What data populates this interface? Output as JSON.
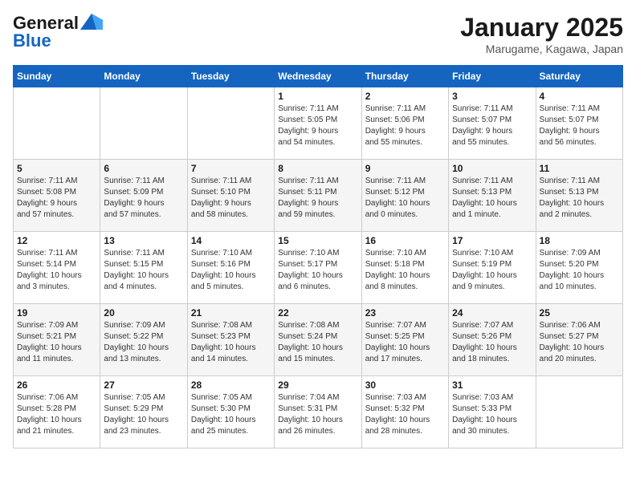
{
  "header": {
    "logo_line1": "General",
    "logo_line2": "Blue",
    "month": "January 2025",
    "location": "Marugame, Kagawa, Japan"
  },
  "weekdays": [
    "Sunday",
    "Monday",
    "Tuesday",
    "Wednesday",
    "Thursday",
    "Friday",
    "Saturday"
  ],
  "weeks": [
    [
      {
        "day": "",
        "info": ""
      },
      {
        "day": "",
        "info": ""
      },
      {
        "day": "",
        "info": ""
      },
      {
        "day": "1",
        "info": "Sunrise: 7:11 AM\nSunset: 5:05 PM\nDaylight: 9 hours\nand 54 minutes."
      },
      {
        "day": "2",
        "info": "Sunrise: 7:11 AM\nSunset: 5:06 PM\nDaylight: 9 hours\nand 55 minutes."
      },
      {
        "day": "3",
        "info": "Sunrise: 7:11 AM\nSunset: 5:07 PM\nDaylight: 9 hours\nand 55 minutes."
      },
      {
        "day": "4",
        "info": "Sunrise: 7:11 AM\nSunset: 5:07 PM\nDaylight: 9 hours\nand 56 minutes."
      }
    ],
    [
      {
        "day": "5",
        "info": "Sunrise: 7:11 AM\nSunset: 5:08 PM\nDaylight: 9 hours\nand 57 minutes."
      },
      {
        "day": "6",
        "info": "Sunrise: 7:11 AM\nSunset: 5:09 PM\nDaylight: 9 hours\nand 57 minutes."
      },
      {
        "day": "7",
        "info": "Sunrise: 7:11 AM\nSunset: 5:10 PM\nDaylight: 9 hours\nand 58 minutes."
      },
      {
        "day": "8",
        "info": "Sunrise: 7:11 AM\nSunset: 5:11 PM\nDaylight: 9 hours\nand 59 minutes."
      },
      {
        "day": "9",
        "info": "Sunrise: 7:11 AM\nSunset: 5:12 PM\nDaylight: 10 hours\nand 0 minutes."
      },
      {
        "day": "10",
        "info": "Sunrise: 7:11 AM\nSunset: 5:13 PM\nDaylight: 10 hours\nand 1 minute."
      },
      {
        "day": "11",
        "info": "Sunrise: 7:11 AM\nSunset: 5:13 PM\nDaylight: 10 hours\nand 2 minutes."
      }
    ],
    [
      {
        "day": "12",
        "info": "Sunrise: 7:11 AM\nSunset: 5:14 PM\nDaylight: 10 hours\nand 3 minutes."
      },
      {
        "day": "13",
        "info": "Sunrise: 7:11 AM\nSunset: 5:15 PM\nDaylight: 10 hours\nand 4 minutes."
      },
      {
        "day": "14",
        "info": "Sunrise: 7:10 AM\nSunset: 5:16 PM\nDaylight: 10 hours\nand 5 minutes."
      },
      {
        "day": "15",
        "info": "Sunrise: 7:10 AM\nSunset: 5:17 PM\nDaylight: 10 hours\nand 6 minutes."
      },
      {
        "day": "16",
        "info": "Sunrise: 7:10 AM\nSunset: 5:18 PM\nDaylight: 10 hours\nand 8 minutes."
      },
      {
        "day": "17",
        "info": "Sunrise: 7:10 AM\nSunset: 5:19 PM\nDaylight: 10 hours\nand 9 minutes."
      },
      {
        "day": "18",
        "info": "Sunrise: 7:09 AM\nSunset: 5:20 PM\nDaylight: 10 hours\nand 10 minutes."
      }
    ],
    [
      {
        "day": "19",
        "info": "Sunrise: 7:09 AM\nSunset: 5:21 PM\nDaylight: 10 hours\nand 11 minutes."
      },
      {
        "day": "20",
        "info": "Sunrise: 7:09 AM\nSunset: 5:22 PM\nDaylight: 10 hours\nand 13 minutes."
      },
      {
        "day": "21",
        "info": "Sunrise: 7:08 AM\nSunset: 5:23 PM\nDaylight: 10 hours\nand 14 minutes."
      },
      {
        "day": "22",
        "info": "Sunrise: 7:08 AM\nSunset: 5:24 PM\nDaylight: 10 hours\nand 15 minutes."
      },
      {
        "day": "23",
        "info": "Sunrise: 7:07 AM\nSunset: 5:25 PM\nDaylight: 10 hours\nand 17 minutes."
      },
      {
        "day": "24",
        "info": "Sunrise: 7:07 AM\nSunset: 5:26 PM\nDaylight: 10 hours\nand 18 minutes."
      },
      {
        "day": "25",
        "info": "Sunrise: 7:06 AM\nSunset: 5:27 PM\nDaylight: 10 hours\nand 20 minutes."
      }
    ],
    [
      {
        "day": "26",
        "info": "Sunrise: 7:06 AM\nSunset: 5:28 PM\nDaylight: 10 hours\nand 21 minutes."
      },
      {
        "day": "27",
        "info": "Sunrise: 7:05 AM\nSunset: 5:29 PM\nDaylight: 10 hours\nand 23 minutes."
      },
      {
        "day": "28",
        "info": "Sunrise: 7:05 AM\nSunset: 5:30 PM\nDaylight: 10 hours\nand 25 minutes."
      },
      {
        "day": "29",
        "info": "Sunrise: 7:04 AM\nSunset: 5:31 PM\nDaylight: 10 hours\nand 26 minutes."
      },
      {
        "day": "30",
        "info": "Sunrise: 7:03 AM\nSunset: 5:32 PM\nDaylight: 10 hours\nand 28 minutes."
      },
      {
        "day": "31",
        "info": "Sunrise: 7:03 AM\nSunset: 5:33 PM\nDaylight: 10 hours\nand 30 minutes."
      },
      {
        "day": "",
        "info": ""
      }
    ]
  ]
}
